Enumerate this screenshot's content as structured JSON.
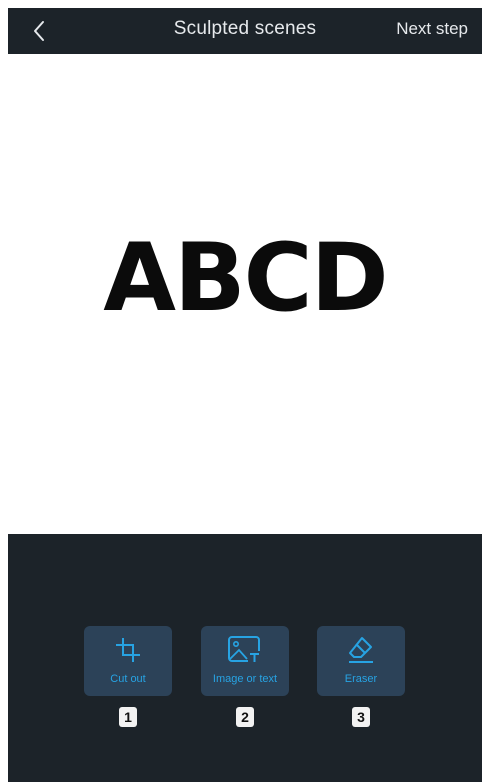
{
  "header": {
    "back_icon": "chevron-left-icon",
    "title": "Sculpted scenes",
    "next_label": "Next step"
  },
  "canvas": {
    "text": "ABCD"
  },
  "tools": [
    {
      "label": "Cut out",
      "icon": "crop-icon",
      "step": "1"
    },
    {
      "label": "Image or text",
      "icon": "image-text-icon",
      "step": "2"
    },
    {
      "label": "Eraser",
      "icon": "eraser-icon",
      "step": "3"
    }
  ],
  "colors": {
    "bar_background": "#1c2329",
    "tool_background": "#2c4258",
    "tool_accent": "#27a3e3",
    "canvas_background": "#ffffff"
  }
}
